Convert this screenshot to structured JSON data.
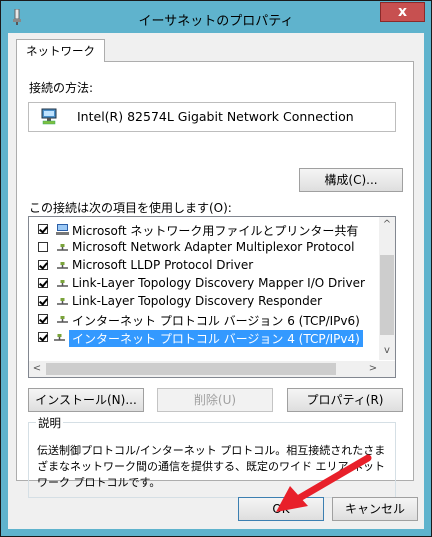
{
  "window": {
    "title": "イーサネットのプロパティ",
    "close_label": "x"
  },
  "tab": {
    "label": "ネットワーク"
  },
  "connection": {
    "heading": "接続の方法:",
    "adapter_name": "Intel(R) 82574L Gigabit Network Connection",
    "configure_label": "構成(C)..."
  },
  "items": {
    "heading": "この接続は次の項目を使用します(O):",
    "list": [
      {
        "label": "Microsoft ネットワーク用ファイルとプリンター共有",
        "checked": true,
        "icon": "file-share-icon"
      },
      {
        "label": "Microsoft Network Adapter Multiplexor Protocol",
        "checked": false,
        "icon": "protocol-icon"
      },
      {
        "label": "Microsoft LLDP Protocol Driver",
        "checked": true,
        "icon": "protocol-icon"
      },
      {
        "label": "Link-Layer Topology Discovery Mapper I/O Driver",
        "checked": true,
        "icon": "protocol-icon"
      },
      {
        "label": "Link-Layer Topology Discovery Responder",
        "checked": true,
        "icon": "protocol-icon"
      },
      {
        "label": "インターネット プロトコル バージョン 6 (TCP/IPv6)",
        "checked": true,
        "icon": "protocol-icon"
      },
      {
        "label": "インターネット プロトコル バージョン 4 (TCP/IPv4)",
        "checked": true,
        "icon": "protocol-icon",
        "selected": true
      }
    ],
    "scroll_up": "^",
    "scroll_down": "v",
    "scroll_left": "<",
    "scroll_right": ">"
  },
  "buttons": {
    "install": "インストール(N)...",
    "uninstall": "削除(U)",
    "properties": "プロパティ(R)"
  },
  "description": {
    "heading": "説明",
    "text": "伝送制御プロトコル/インターネット プロトコル。相互接続されたさまざまなネットワーク間の通信を提供する、既定のワイド エリア ネットワーク プロトコルです。"
  },
  "footer": {
    "ok": "OK",
    "cancel": "キャンセル"
  },
  "colors": {
    "title_bar": "#5fb3cd",
    "close_button": "#c75050",
    "selection": "#3399ff",
    "annotation_arrow": "#e8202a"
  }
}
